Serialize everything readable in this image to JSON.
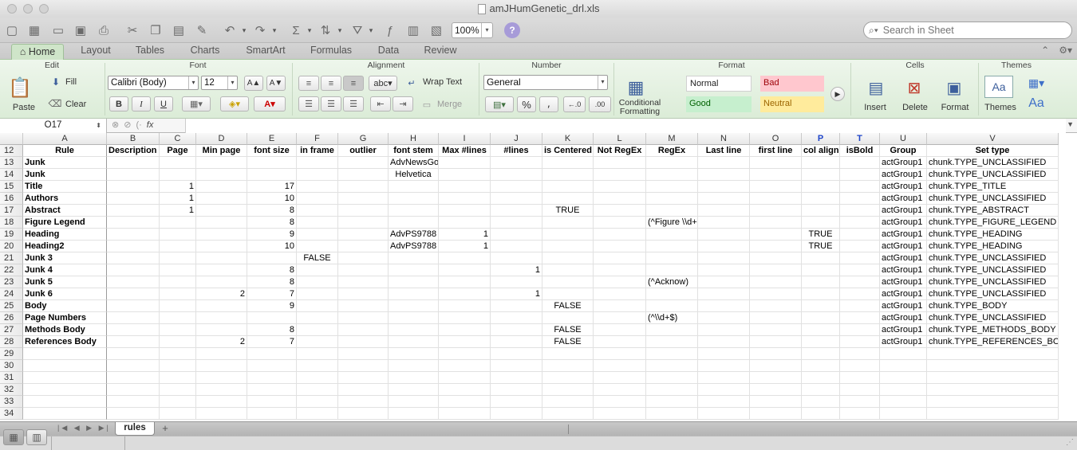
{
  "window": {
    "title": "amJHumGenetic_drl.xls"
  },
  "toolbar": {
    "zoom": "100%",
    "search_placeholder": "Search in Sheet"
  },
  "ribbon_tabs": [
    "Home",
    "Layout",
    "Tables",
    "Charts",
    "SmartArt",
    "Formulas",
    "Data",
    "Review"
  ],
  "ribbon": {
    "groups": {
      "edit": "Edit",
      "font": "Font",
      "alignment": "Alignment",
      "number": "Number",
      "format": "Format",
      "cells": "Cells",
      "themes": "Themes"
    },
    "edit": {
      "paste": "Paste",
      "fill": "Fill",
      "clear": "Clear"
    },
    "font": {
      "name": "Calibri (Body)",
      "size": "12",
      "bold": "B",
      "italic": "I",
      "underline": "U",
      "grow": "A▲",
      "shrink": "A▼"
    },
    "alignment": {
      "abc": "abc",
      "wrap_text": "Wrap Text",
      "merge": "Merge"
    },
    "number": {
      "format": "General",
      "percent": "%",
      "comma": "⸴"
    },
    "format": {
      "conditional": "Conditional Formatting",
      "normal": "Normal",
      "bad": "Bad",
      "good": "Good",
      "neutral": "Neutral"
    },
    "cells": {
      "insert": "Insert",
      "delete": "Delete",
      "format": "Format"
    },
    "themes": {
      "themes": "Themes",
      "aa": "Aa"
    }
  },
  "formula_bar": {
    "name_box": "O17",
    "fx": "fx",
    "content": ""
  },
  "columns": [
    {
      "letter": "A",
      "highlight": false
    },
    {
      "letter": "B",
      "highlight": false
    },
    {
      "letter": "C",
      "highlight": false
    },
    {
      "letter": "D",
      "highlight": false
    },
    {
      "letter": "E",
      "highlight": false
    },
    {
      "letter": "F",
      "highlight": false
    },
    {
      "letter": "G",
      "highlight": false
    },
    {
      "letter": "H",
      "highlight": false
    },
    {
      "letter": "I",
      "highlight": false
    },
    {
      "letter": "J",
      "highlight": false
    },
    {
      "letter": "K",
      "highlight": false
    },
    {
      "letter": "L",
      "highlight": false
    },
    {
      "letter": "M",
      "highlight": false
    },
    {
      "letter": "N",
      "highlight": false
    },
    {
      "letter": "O",
      "highlight": false
    },
    {
      "letter": "P",
      "highlight": true
    },
    {
      "letter": "T",
      "highlight": true
    },
    {
      "letter": "U",
      "highlight": false
    },
    {
      "letter": "V",
      "highlight": false
    }
  ],
  "rows": [
    {
      "num": "12",
      "cells": [
        "Rule",
        "Description of",
        "Page",
        "Min page",
        "font size",
        "in frame",
        "outlier",
        "font stem",
        "Max #lines",
        "#lines",
        "is Centered",
        "Not RegEx",
        "RegEx",
        "Last line",
        "first line",
        "col align",
        "isBold",
        "Group",
        "Set type"
      ]
    },
    {
      "num": "13",
      "cells": [
        "Junk",
        "",
        "",
        "",
        "",
        "",
        "",
        "AdvNewsGothic",
        "",
        "",
        "",
        "",
        "",
        "",
        "",
        "",
        "",
        "actGroup1",
        "chunk.TYPE_UNCLASSIFIED"
      ]
    },
    {
      "num": "14",
      "cells": [
        "Junk",
        "",
        "",
        "",
        "",
        "",
        "",
        "Helvetica",
        "",
        "",
        "",
        "",
        "",
        "",
        "",
        "",
        "",
        "actGroup1",
        "chunk.TYPE_UNCLASSIFIED"
      ]
    },
    {
      "num": "15",
      "cells": [
        "Title",
        "",
        "1",
        "",
        "17",
        "",
        "",
        "",
        "",
        "",
        "",
        "",
        "",
        "",
        "",
        "",
        "",
        "actGroup1",
        "chunk.TYPE_TITLE"
      ]
    },
    {
      "num": "16",
      "cells": [
        "Authors",
        "",
        "1",
        "",
        "10",
        "",
        "",
        "",
        "",
        "",
        "",
        "",
        "",
        "",
        "",
        "",
        "",
        "actGroup1",
        "chunk.TYPE_UNCLASSIFIED"
      ]
    },
    {
      "num": "17",
      "cells": [
        "Abstract",
        "",
        "1",
        "",
        "8",
        "",
        "",
        "",
        "",
        "",
        "TRUE",
        "",
        "",
        "",
        "",
        "",
        "",
        "actGroup1",
        "chunk.TYPE_ABSTRACT"
      ]
    },
    {
      "num": "18",
      "cells": [
        "Figure Legend",
        "",
        "",
        "",
        "8",
        "",
        "",
        "",
        "",
        "",
        "",
        "",
        "(^Figure \\\\d+)",
        "",
        "",
        "",
        "",
        "actGroup1",
        "chunk.TYPE_FIGURE_LEGEND"
      ]
    },
    {
      "num": "19",
      "cells": [
        "Heading",
        "",
        "",
        "",
        "9",
        "",
        "",
        "AdvPS9788",
        "1",
        "",
        "",
        "",
        "",
        "",
        "",
        "TRUE",
        "",
        "actGroup1",
        "chunk.TYPE_HEADING"
      ]
    },
    {
      "num": "20",
      "cells": [
        "Heading2",
        "",
        "",
        "",
        "10",
        "",
        "",
        "AdvPS9788",
        "1",
        "",
        "",
        "",
        "",
        "",
        "",
        "TRUE",
        "",
        "actGroup1",
        "chunk.TYPE_HEADING"
      ]
    },
    {
      "num": "21",
      "cells": [
        "Junk 3",
        "",
        "",
        "",
        "",
        "FALSE",
        "",
        "",
        "",
        "",
        "",
        "",
        "",
        "",
        "",
        "",
        "",
        "actGroup1",
        "chunk.TYPE_UNCLASSIFIED"
      ]
    },
    {
      "num": "22",
      "cells": [
        "Junk 4",
        "",
        "",
        "",
        "8",
        "",
        "",
        "",
        "",
        "1",
        "",
        "",
        "",
        "",
        "",
        "",
        "",
        "actGroup1",
        "chunk.TYPE_UNCLASSIFIED"
      ]
    },
    {
      "num": "23",
      "cells": [
        "Junk 5",
        "",
        "",
        "",
        "8",
        "",
        "",
        "",
        "",
        "",
        "",
        "",
        "(^Acknow)",
        "",
        "",
        "",
        "",
        "actGroup1",
        "chunk.TYPE_UNCLASSIFIED"
      ]
    },
    {
      "num": "24",
      "cells": [
        "Junk 6",
        "",
        "",
        "2",
        "7",
        "",
        "",
        "",
        "",
        "1",
        "",
        "",
        "",
        "",
        "",
        "",
        "",
        "actGroup1",
        "chunk.TYPE_UNCLASSIFIED"
      ]
    },
    {
      "num": "25",
      "cells": [
        "Body",
        "",
        "",
        "",
        "9",
        "",
        "",
        "",
        "",
        "",
        "FALSE",
        "",
        "",
        "",
        "",
        "",
        "",
        "actGroup1",
        "chunk.TYPE_BODY"
      ]
    },
    {
      "num": "26",
      "cells": [
        "Page Numbers",
        "",
        "",
        "",
        "",
        "",
        "",
        "",
        "",
        "",
        "",
        "",
        "(^\\\\d+$)",
        "",
        "",
        "",
        "",
        "actGroup1",
        "chunk.TYPE_UNCLASSIFIED"
      ]
    },
    {
      "num": "27",
      "cells": [
        "Methods Body",
        "",
        "",
        "",
        "8",
        "",
        "",
        "",
        "",
        "",
        "FALSE",
        "",
        "",
        "",
        "",
        "",
        "",
        "actGroup1",
        "chunk.TYPE_METHODS_BODY"
      ]
    },
    {
      "num": "28",
      "cells": [
        "References Body",
        "",
        "",
        "2",
        "7",
        "",
        "",
        "",
        "",
        "",
        "FALSE",
        "",
        "",
        "",
        "",
        "",
        "",
        "actGroup1",
        "chunk.TYPE_REFERENCES_BODY"
      ]
    },
    {
      "num": "29",
      "cells": []
    },
    {
      "num": "30",
      "cells": []
    },
    {
      "num": "31",
      "cells": []
    },
    {
      "num": "32",
      "cells": []
    },
    {
      "num": "33",
      "cells": []
    },
    {
      "num": "34",
      "cells": []
    }
  ],
  "sheets": [
    {
      "name": "rules",
      "active": true
    }
  ],
  "colors": {
    "ribbon": "#dbecd7",
    "good": "#c6efce",
    "bad": "#ffc7ce",
    "neutral": "#ffeb9c",
    "highlight_col": "#1f45c9"
  }
}
